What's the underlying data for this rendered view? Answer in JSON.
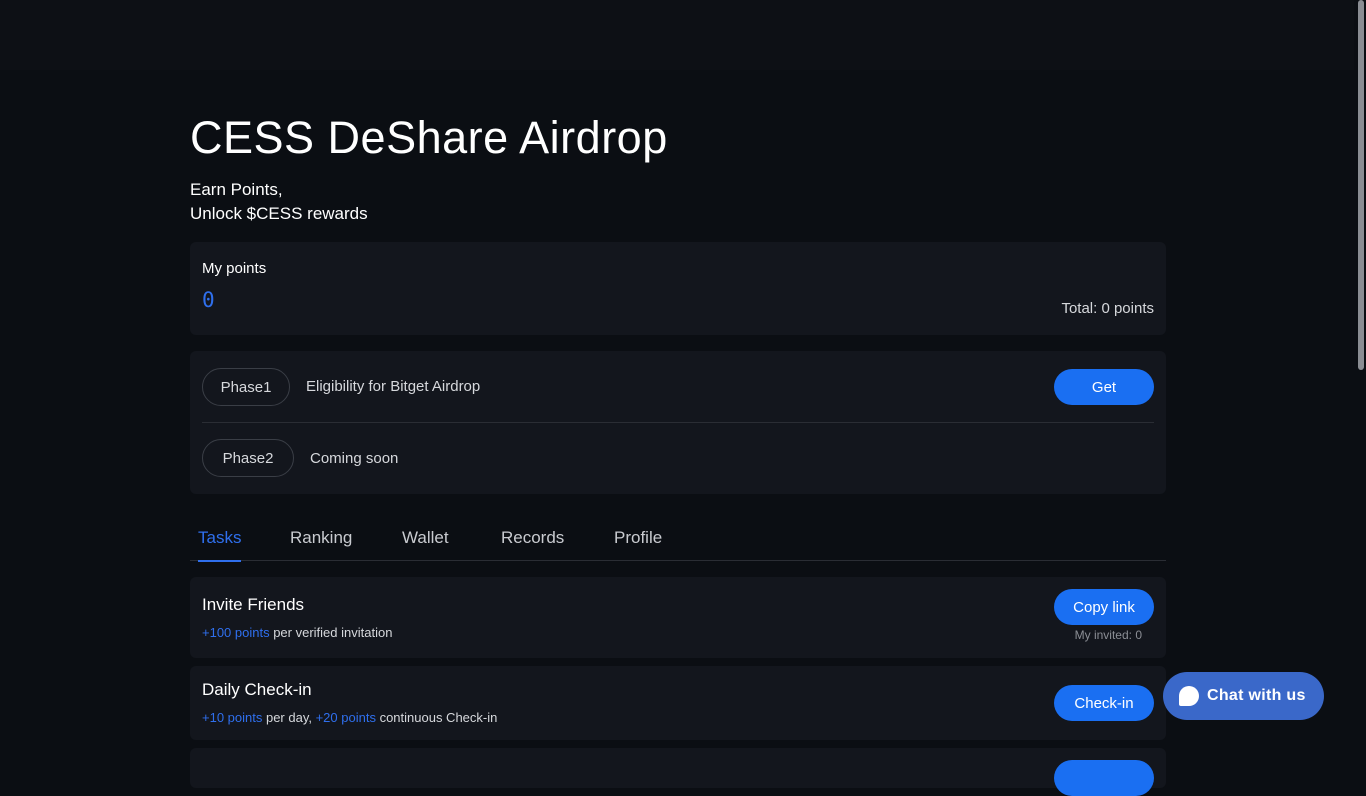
{
  "page": {
    "title": "CESS DeShare Airdrop",
    "subtitle_line1": "Earn Points,",
    "subtitle_line2": "Unlock $CESS rewards"
  },
  "points": {
    "label": "My points",
    "value": "0",
    "total": "Total: 0 points"
  },
  "phases": [
    {
      "pill": "Phase1",
      "text": "Eligibility for Bitget Airdrop",
      "button": "Get"
    },
    {
      "pill": "Phase2",
      "text": "Coming soon"
    }
  ],
  "tabs": [
    {
      "label": "Tasks",
      "active": true
    },
    {
      "label": "Ranking",
      "active": false
    },
    {
      "label": "Wallet",
      "active": false
    },
    {
      "label": "Records",
      "active": false
    },
    {
      "label": "Profile",
      "active": false
    }
  ],
  "tasks": [
    {
      "title": "Invite Friends",
      "desc_accent": "+100 points",
      "desc_rest": " per verified invitation",
      "button": "Copy link",
      "note": "My invited: 0"
    },
    {
      "title": "Daily Check-in",
      "desc_accent1": "+10 points",
      "desc_mid": " per day, ",
      "desc_accent2": "+20 points",
      "desc_rest": " continuous Check-in",
      "button": "Check-in"
    }
  ],
  "chat": {
    "label": "Chat with us",
    "icon": "chat-bubble-icon"
  },
  "colors": {
    "accent": "#1a6ff2",
    "background": "#0b0e13",
    "card": "#13161d",
    "chat": "#3a68c9"
  }
}
